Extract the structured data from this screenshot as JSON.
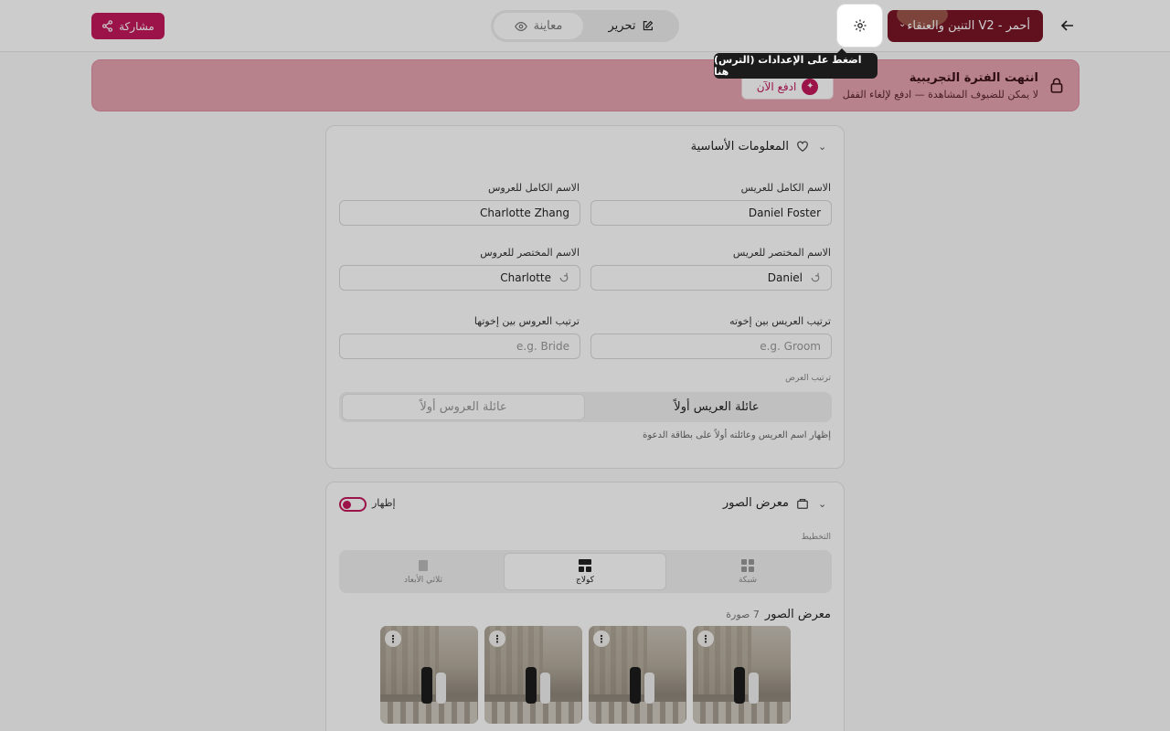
{
  "header": {
    "share_label": "مشاركة",
    "mode_preview_label": "معاينة",
    "mode_edit_label": "تحرير",
    "theme_label": "التنين والعنقاء V2 - أحمر",
    "settings_tooltip": "اضغط على الإعدادات (الترس) هنا"
  },
  "banner": {
    "title": "انتهت الفترة التجريبية",
    "subtitle": "لا يمكن للضيوف المشاهدة — ادفع لإلغاء القفل",
    "pay_label": "ادفع الآن"
  },
  "basic_info": {
    "section_title": "المعلومات الأساسية",
    "groom_full_label": "الاسم الكامل للعريس",
    "groom_full_value": "Daniel Foster",
    "bride_full_label": "الاسم الكامل للعروس",
    "bride_full_value": "Charlotte Zhang",
    "groom_short_label": "الاسم المختصر للعريس",
    "groom_short_value": "Daniel",
    "bride_short_label": "الاسم المختصر للعروس",
    "bride_short_value": "Charlotte",
    "groom_order_label": "ترتيب العريس بين إخوته",
    "groom_order_placeholder": "e.g. Groom",
    "bride_order_label": "ترتيب العروس بين إخوتها",
    "bride_order_placeholder": "e.g. Bride",
    "display_order_label": "ترتيب العرض",
    "option_groom_first": "عائلة العريس أولاً",
    "option_bride_first": "عائلة العروس أولاً",
    "hint": "إظهار اسم العريس وعائلته أولاً على بطاقة الدعوة"
  },
  "gallery": {
    "section_title": "معرض الصور",
    "show_label": "إظهار",
    "layout_label": "التخطيط",
    "layout_grid": "شبكة",
    "layout_collage": "كولاج",
    "layout_3d": "ثلاثي الأبعاد",
    "gallery_label": "معرض الصور",
    "photo_count": "7 صورة",
    "photos": [
      {
        "menu": "⋮"
      },
      {
        "menu": "⋮"
      },
      {
        "menu": "⋮"
      },
      {
        "menu": "⋮"
      }
    ]
  },
  "colors": {
    "accent": "#c2185b",
    "banner_bg": "#e6a3b1",
    "theme_bg": "#7a1426"
  }
}
